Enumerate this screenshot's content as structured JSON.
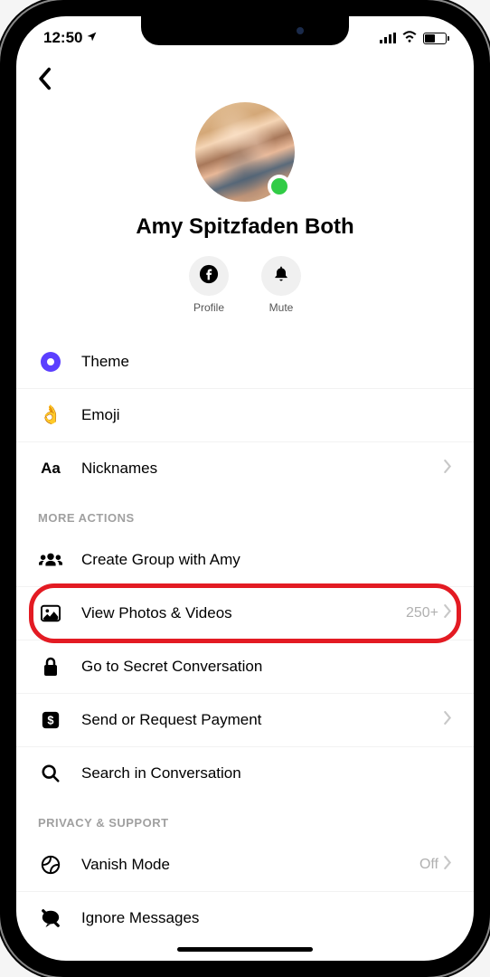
{
  "status": {
    "time": "12:50",
    "location_arrow": "➤"
  },
  "profile": {
    "name": "Amy Spitzfaden Both",
    "online": true
  },
  "actions": {
    "profile_label": "Profile",
    "mute_label": "Mute"
  },
  "customize": {
    "theme": "Theme",
    "emoji": "Emoji",
    "nicknames": "Nicknames"
  },
  "sections": {
    "more_actions": "MORE ACTIONS",
    "privacy_support": "PRIVACY & SUPPORT"
  },
  "more_actions": {
    "create_group": "Create Group with Amy",
    "view_photos": "View Photos & Videos",
    "view_photos_count": "250+",
    "secret_conversation": "Go to Secret Conversation",
    "payment": "Send or Request Payment",
    "search": "Search in Conversation"
  },
  "privacy": {
    "vanish_mode": "Vanish Mode",
    "vanish_mode_value": "Off",
    "ignore": "Ignore Messages"
  }
}
